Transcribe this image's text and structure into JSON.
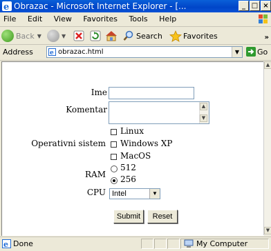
{
  "window": {
    "title": "Obrazac - Microsoft Internet Explorer - [...",
    "min_label": "_",
    "max_label": "□",
    "close_label": "×"
  },
  "menu": {
    "file": "File",
    "edit": "Edit",
    "view": "View",
    "favorites": "Favorites",
    "tools": "Tools",
    "help": "Help"
  },
  "toolbar": {
    "back": "Back",
    "search": "Search",
    "favorites": "Favorites"
  },
  "address": {
    "label": "Address",
    "value": "obrazac.html",
    "go": "Go"
  },
  "form": {
    "ime_label": "Ime",
    "komentar_label": "Komentar",
    "os_label": "Operativni sistem",
    "os_options": [
      "Linux",
      "Windows XP",
      "MacOS"
    ],
    "ram_label": "RAM",
    "ram_options": [
      "512",
      "256"
    ],
    "ram_selected": "256",
    "cpu_label": "CPU",
    "cpu_value": "Intel",
    "submit": "Submit",
    "reset": "Reset"
  },
  "status": {
    "text": "Done",
    "zone": "My Computer"
  },
  "colors": {
    "titlebar": "#0a52d6",
    "chrome": "#ece9d8",
    "desktop": "#0a2a9a"
  },
  "icons": [
    "ie-icon",
    "windows-flag-icon",
    "back-icon",
    "forward-icon",
    "stop-icon",
    "refresh-icon",
    "home-icon",
    "search-icon",
    "favorites-star-icon",
    "page-icon",
    "go-arrow-icon",
    "computer-icon"
  ]
}
